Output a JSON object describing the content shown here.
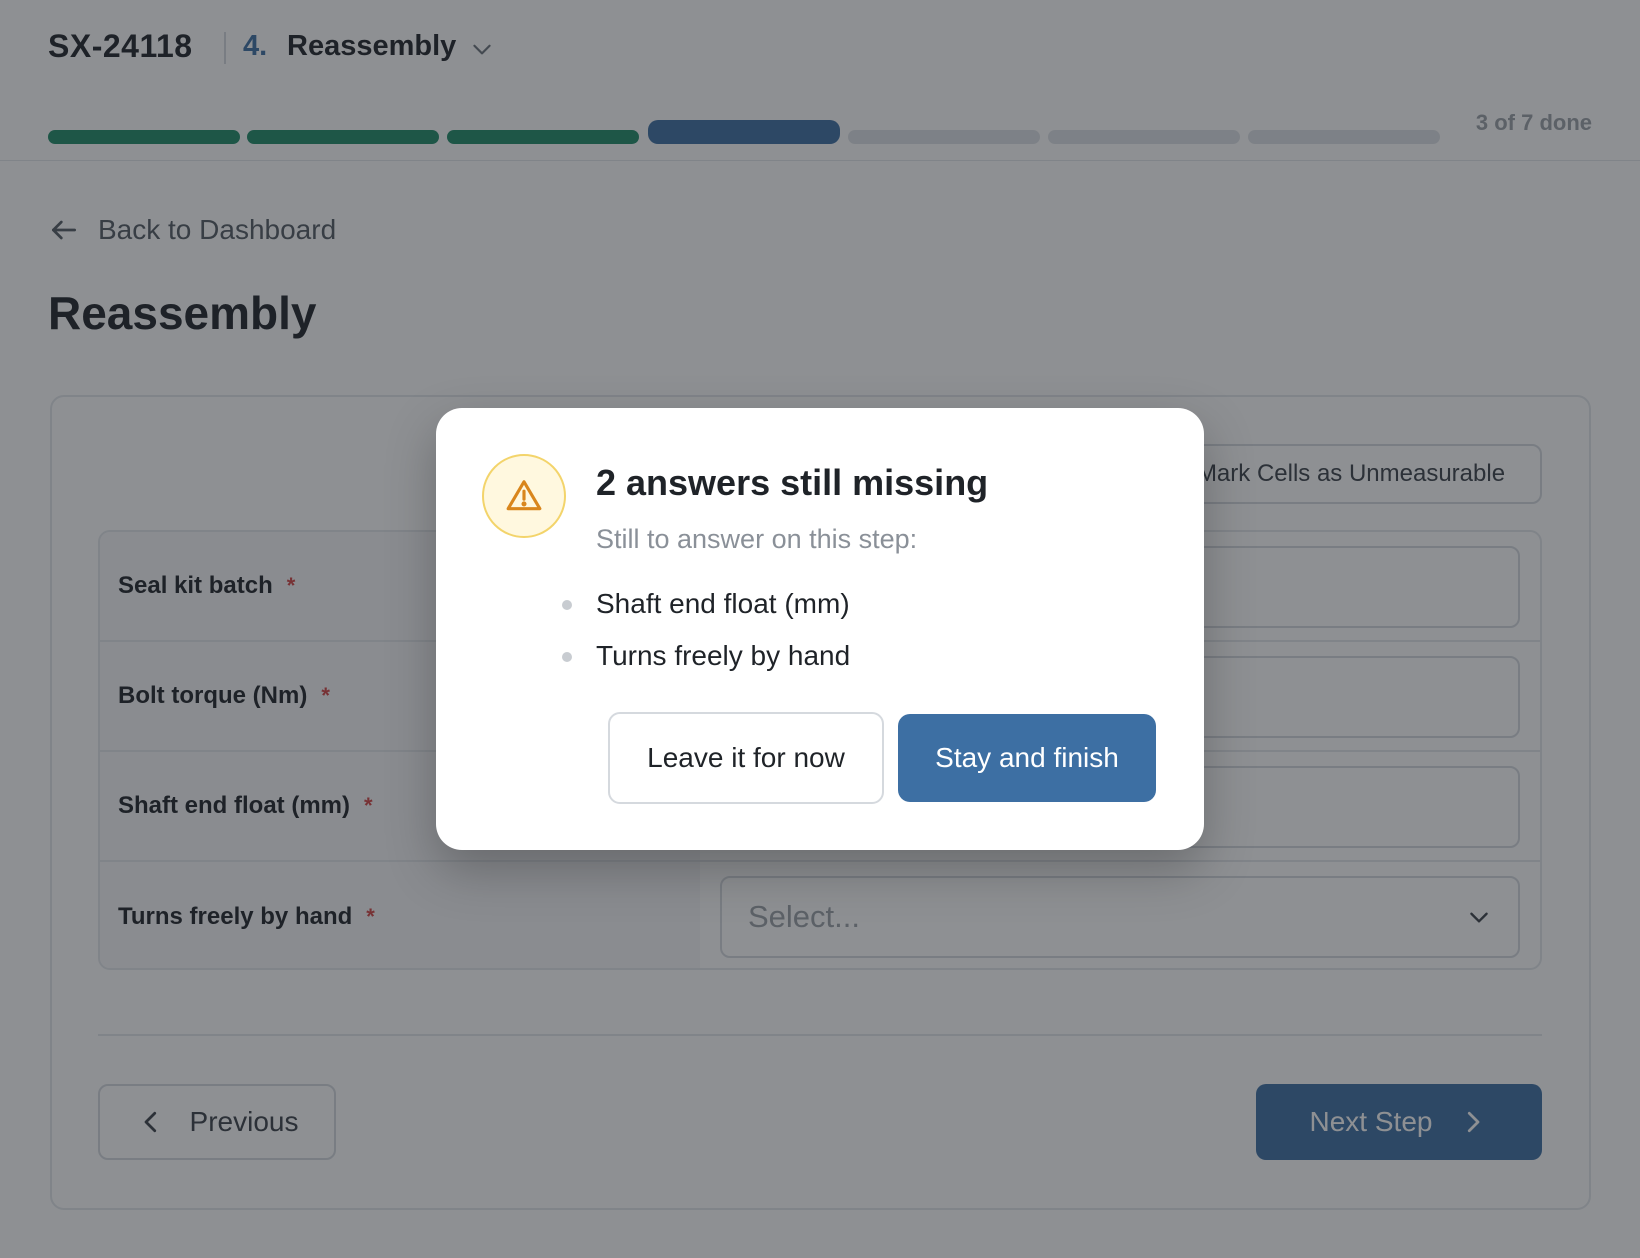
{
  "header": {
    "job_id": "SX-24118",
    "step_number": "4.",
    "step_name": "Reassembly",
    "progress": {
      "segments_total": 7,
      "segments_done": 3,
      "current_segment": 4,
      "label": "3 of 7 done"
    }
  },
  "nav": {
    "back_label": "Back to Dashboard"
  },
  "page": {
    "title": "Reassembly",
    "unmeasurable_label": "Mark Cells as Unmeasurable",
    "fields": [
      {
        "label": "Seal kit batch",
        "required_mark": "*",
        "value": ""
      },
      {
        "label": "Bolt torque (Nm)",
        "required_mark": "*",
        "value": ""
      },
      {
        "label": "Shaft end float (mm)",
        "required_mark": "*",
        "value": ""
      },
      {
        "label": "Turns freely by hand",
        "required_mark": "*",
        "placeholder": "Select..."
      }
    ],
    "previous_label": "Previous",
    "next_label": "Next Step"
  },
  "modal": {
    "title": "2 answers still missing",
    "subtitle": "Still to answer on this step:",
    "missing_items": [
      "Shaft end float (mm)",
      "Turns freely by hand"
    ],
    "secondary_label": "Leave it for now",
    "primary_label": "Stay and finish"
  },
  "icons": {
    "back": "arrow-left-icon",
    "step_dropdown": "chevron-down-icon",
    "warning": "warning-triangle-icon",
    "previous": "chevron-left-icon",
    "next": "chevron-right-icon"
  },
  "colors": {
    "accent": "#3d6fa3",
    "done": "#1e8a67",
    "required": "#d14343",
    "warning": "#d9861c"
  }
}
